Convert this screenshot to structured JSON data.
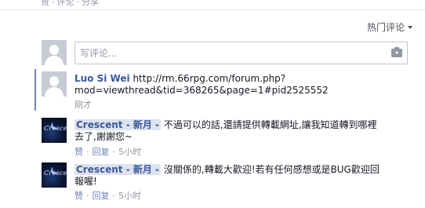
{
  "top_actions": [
    "赞",
    "评论",
    "分享"
  ],
  "sort": {
    "label": "热门评论"
  },
  "compose": {
    "placeholder": "写评论..."
  },
  "comments": [
    {
      "author": "Luo Si Wei",
      "text": "http://rm.66rpg.com/forum.php?mod=viewthread&tid=368265&page=1#pid2525552",
      "line1": "http://rm.66rpg.com/forum.php?",
      "line2": "mod=viewthread&tid=368265&page=1#pid2525552",
      "time": "刚才"
    },
    {
      "author": "Crescent - 新月 -",
      "text": "不過可以的話,還請提供轉載網址,讓我知道轉到哪裡去了,謝謝您~",
      "line1": "不過可以的話,還請提供轉載網址,讓我知道轉到哪裡",
      "line2": "去了,謝謝您~",
      "like": "赞",
      "reply": "回复",
      "time": "5小时"
    },
    {
      "author": "Crescent - 新月 -",
      "text": "沒關係的,轉載大歡迎!若有任何感想或是BUG歡迎回報喔!",
      "line1": "沒關係的,轉載大歡迎!若有任何感想或是BUG歡迎回",
      "line2": "報喔!",
      "like": "赞",
      "reply": "回复",
      "time": "5小时"
    }
  ],
  "colors": {
    "link_blue": "#3b5998",
    "meta_gray": "#9197a3",
    "accent_bar": "#6d84b4"
  }
}
